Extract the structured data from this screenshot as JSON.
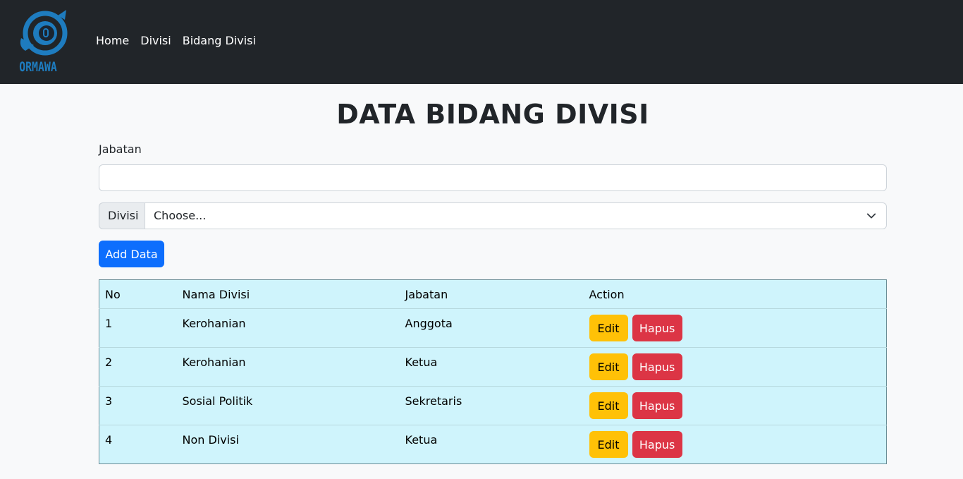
{
  "navbar": {
    "brand_text": "ORMAWA",
    "links": [
      {
        "label": "Home"
      },
      {
        "label": "Divisi"
      },
      {
        "label": "Bidang Divisi"
      }
    ]
  },
  "page": {
    "title": "DATA BIDANG DIVISI"
  },
  "form": {
    "jabatan_label": "Jabatan",
    "jabatan_value": "",
    "divisi_addon": "Divisi",
    "divisi_selected": "Choose...",
    "add_button": "Add Data"
  },
  "table": {
    "headers": [
      "No",
      "Nama Divisi",
      "Jabatan",
      "Action"
    ],
    "rows": [
      {
        "no": "1",
        "nama": "Kerohanian",
        "jabatan": "Anggota",
        "edit": "Edit",
        "hapus": "Hapus"
      },
      {
        "no": "2",
        "nama": "Kerohanian",
        "jabatan": "Ketua",
        "edit": "Edit",
        "hapus": "Hapus"
      },
      {
        "no": "3",
        "nama": "Sosial Politik",
        "jabatan": "Sekretaris",
        "edit": "Edit",
        "hapus": "Hapus"
      },
      {
        "no": "4",
        "nama": "Non Divisi",
        "jabatan": "Ketua",
        "edit": "Edit",
        "hapus": "Hapus"
      }
    ]
  },
  "colors": {
    "navbar_bg": "#212529",
    "brand_blue": "#1e7cbf",
    "primary": "#0d6efd",
    "warning": "#ffc107",
    "danger": "#dc3545",
    "table_info": "#cff4fc"
  },
  "icons": {
    "logo": "ormawa-logo-icon",
    "select_arrow": "chevron-down-icon"
  }
}
